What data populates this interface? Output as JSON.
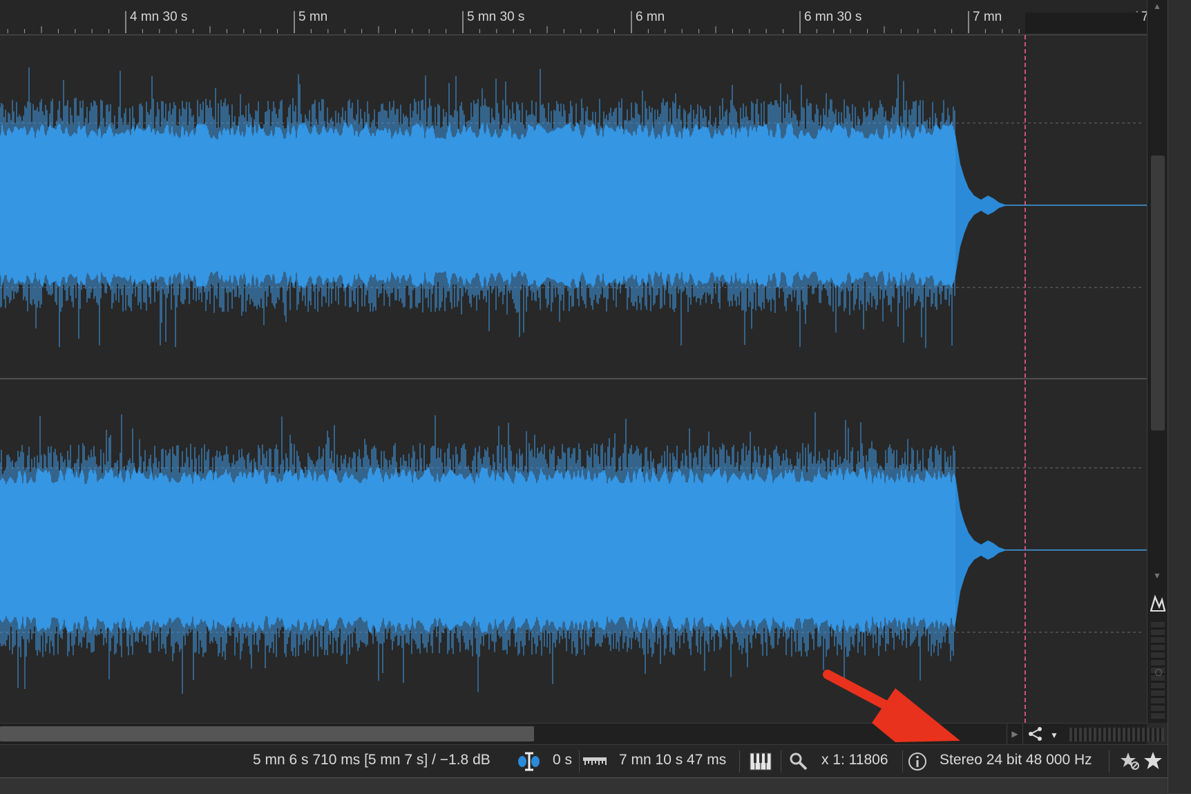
{
  "ruler": {
    "labels": [
      "4 mn 30 s",
      "5 mn",
      "5 mn 30 s",
      "6 mn",
      "6 mn 30 s",
      "7 mn",
      "7"
    ]
  },
  "statusbar": {
    "cursor_readout": "5 mn 6 s 710 ms [5 mn 7 s] / −1.8 dB",
    "selection_length": "0 s",
    "file_length": "7 mn 10 s 47 ms",
    "zoom_value": "x 1: 11806",
    "audio_format": "Stereo 24 bit 48 000 Hz"
  },
  "icons": {
    "selection": "selection-cursor-icon",
    "ruler": "ruler-icon",
    "keyboard": "piano-keyboard-icon",
    "zoom": "magnifier-icon",
    "info": "info-icon",
    "star_add": "star-add-icon",
    "star": "star-icon",
    "share": "share-icon",
    "waveform_tool": "waveform-tool-icon"
  },
  "colors": {
    "waveform": "#2b8bd9",
    "waveform_peak": "#3fa0ee",
    "playhead": "#d0557a",
    "annotation": "#e8321d"
  }
}
